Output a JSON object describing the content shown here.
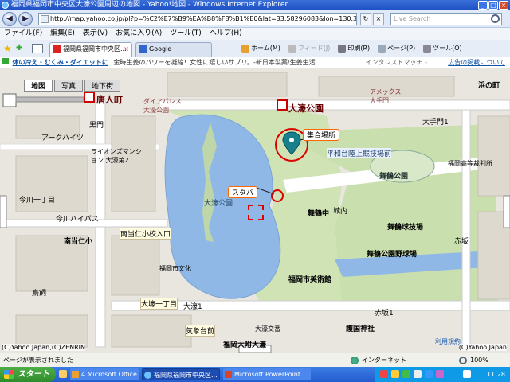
{
  "window": {
    "title": "福岡県福岡市中央区大濠公園周辺の地図 - Yahoo!地図 - Windows Internet Explorer",
    "min": "_",
    "max": "□",
    "close": "×"
  },
  "address": {
    "back": "◀",
    "forward": "▶",
    "url": "http://map.yahoo.co.jp/pl?p=%C2%E7%B9%EA%B8%F8%B1%E0&lat=33.58296083&lon=130.379193",
    "refresh": "↻",
    "stop": "×",
    "search_placeholder": "Live Search"
  },
  "menu": [
    "ファイル(F)",
    "編集(E)",
    "表示(V)",
    "お気に入り(A)",
    "ツール(T)",
    "ヘルプ(H)"
  ],
  "tabs": [
    {
      "label": "福岡県福岡市中央区...",
      "close": "×"
    },
    {
      "label": "Google"
    }
  ],
  "commands": {
    "home": "ホーム(M)",
    "feed": "フィード(J)",
    "print": "印刷(R)",
    "page": "ページ(P)",
    "tools": "ツール(O)"
  },
  "ad": {
    "text": "体の冷え・むくみ・ダイエットに",
    "sub": "金時生姜のパワーを凝縮！女性に嬉しいサプリ。-新日本製薬/生姜生活",
    "source": "インタレストマッチ - ",
    "link": "広告の掲載について"
  },
  "map": {
    "tabs": [
      "地図",
      "写真",
      "地下街"
    ],
    "labels": {
      "station_akasaka": "大濠公園",
      "station_tojin": "唐人町",
      "meeting": "集合場所",
      "starbucks": "スタバ",
      "pond": "大濠公園",
      "park_maizuru": "舞鶴公園",
      "keiba": "平和台陸上競技場",
      "museum": "福岡市美術館",
      "hall": "舞鶴公園野球場",
      "kyudo": "舞鶴球技場",
      "gokoku": "護国神社",
      "ohori_koban": "大濠交番",
      "bunka": "福岡市文化",
      "akasaka": "赤坂",
      "kuromon": "黒門",
      "arcade": "アークハイツ",
      "lions": "ライオンズマンション 大濠第2",
      "uchinoshima": "今川一丁目",
      "imagawa": "今川バイパス",
      "nishijin": "南当仁小",
      "ohori1": "大濠1",
      "tenjin": "大手門1",
      "hamanomachi": "浜の町",
      "fukuoka_high": "福岡高等裁判所",
      "oba": "大壕一丁目",
      "kozan": "城内",
      "meiwa": "舞鶴中",
      "akasaka_sta": "赤坂1",
      "shiba": "鳥飼",
      "ropeway": "福岡大附大濠",
      "ohoritei": "気象台前",
      "nakashu": "南当仁小校入口",
      "heiwadai": "平和台陸上競技場前",
      "mansion": "ダイアパレス 大濠公園",
      "ameritas": "アメックス 大手門"
    },
    "copyright_left": "(C)Yahoo Japan,(C)ZENRIN",
    "copyright_right": "(C)Yahoo Japan",
    "scale": "利用規約"
  },
  "status": {
    "text": "ページが表示されました",
    "zone": "インターネット",
    "zoom": "100%"
  },
  "taskbar": {
    "start": "スタート",
    "items": [
      "4 Microsoft Office ...",
      "福岡県福岡市中央区...",
      "Microsoft PowerPoint..."
    ],
    "clock": "11:28"
  }
}
